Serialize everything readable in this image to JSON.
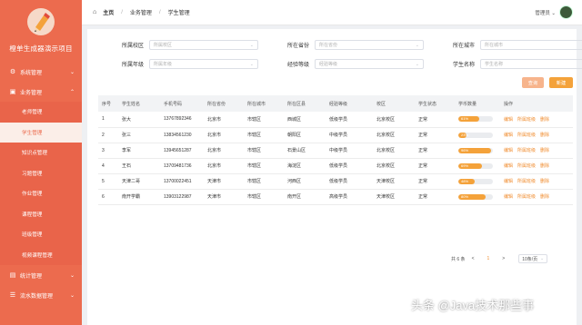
{
  "app": {
    "title": "橙单生成器演示项目"
  },
  "sidebar": {
    "menu": [
      {
        "label": "系统管理",
        "icon": "gear-icon"
      },
      {
        "label": "业务管理",
        "icon": "briefcase-icon"
      }
    ],
    "sub_items": [
      "老师管理",
      "学生管理",
      "知识点管理",
      "习题管理",
      "作业管理",
      "课程管理",
      "班级管理",
      "视频课程管理"
    ],
    "bottom_menu": [
      {
        "label": "统计管理",
        "icon": "chart-icon"
      },
      {
        "label": "流水数据管理",
        "icon": "list-icon"
      }
    ]
  },
  "topbar": {
    "breadcrumb": [
      "主页",
      "业务管理",
      "学生管理"
    ],
    "user_label": "管理员 ⌄"
  },
  "filters": [
    {
      "label": "所属校区",
      "placeholder": "所属校区"
    },
    {
      "label": "所在省份",
      "placeholder": "所在省份"
    },
    {
      "label": "所在城市",
      "placeholder": "所在城市"
    },
    {
      "label": "所属年级",
      "placeholder": "所属年级"
    },
    {
      "label": "经验等级",
      "placeholder": "经验等级"
    },
    {
      "label": "学生名称",
      "placeholder": "学生名称"
    }
  ],
  "buttons": {
    "query": "查询",
    "add": "新建"
  },
  "table": {
    "headers": [
      "序号",
      "学生姓名",
      "手机号码",
      "所在省份",
      "所在城市",
      "所在区县",
      "经验等级",
      "校区",
      "学生状态",
      "学币数量",
      "操作"
    ],
    "rows": [
      {
        "no": "1",
        "name": "张大",
        "phone": "13767892346",
        "province": "北京市",
        "city": "市辖区",
        "district": "西城区",
        "level": "低级学员",
        "campus": "北京校区",
        "status": "正常",
        "coin": 0.61,
        "coin_text": "61%"
      },
      {
        "no": "2",
        "name": "张三",
        "phone": "13834561230",
        "province": "北京市",
        "city": "市辖区",
        "district": "朝阳区",
        "level": "中级学员",
        "campus": "北京校区",
        "status": "正常",
        "coin": 0.23,
        "coin_text": "23%"
      },
      {
        "no": "3",
        "name": "李军",
        "phone": "13945651287",
        "province": "北京市",
        "city": "市辖区",
        "district": "石景山区",
        "level": "中级学员",
        "campus": "北京校区",
        "status": "正常",
        "coin": 0.96,
        "coin_text": "96%"
      },
      {
        "no": "4",
        "name": "王石",
        "phone": "13709481736",
        "province": "北京市",
        "city": "市辖区",
        "district": "海淀区",
        "level": "低级学员",
        "campus": "北京校区",
        "status": "正常",
        "coin": 0.69,
        "coin_text": "69%"
      },
      {
        "no": "5",
        "name": "天津二哥",
        "phone": "13700022451",
        "province": "天津市",
        "city": "市辖区",
        "district": "河西区",
        "level": "低级学员",
        "campus": "天津校区",
        "status": "正常",
        "coin": 0.48,
        "coin_text": "48%"
      },
      {
        "no": "6",
        "name": "南开学霸",
        "phone": "13903122987",
        "province": "天津市",
        "city": "市辖区",
        "district": "南开区",
        "level": "高级学员",
        "campus": "天津校区",
        "status": "正常",
        "coin": 0.8,
        "coin_text": "80%"
      }
    ],
    "actions": [
      "编辑",
      "所属班级",
      "删除"
    ]
  },
  "pager": {
    "total": "共 6 条",
    "prev": "<",
    "page": "1",
    "next": ">",
    "page_size": "10条/页"
  },
  "watermark": "头条 @Java技术那些事",
  "colors": {
    "sidebar": "#ec6b4e",
    "accent": "#f4a23a"
  }
}
